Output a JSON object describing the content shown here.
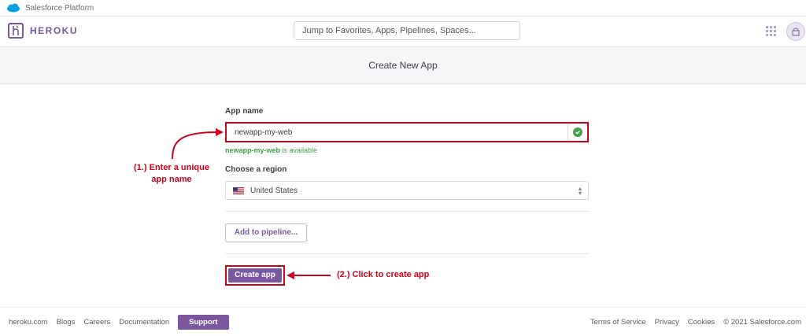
{
  "salesforce_bar": {
    "label": "Salesforce Platform"
  },
  "nav": {
    "logo_text": "HEROKU",
    "search_placeholder": "Jump to Favorites, Apps, Pipelines, Spaces..."
  },
  "page": {
    "title": "Create New App"
  },
  "form": {
    "app_name_label": "App name",
    "app_name_value": "newapp-my-web",
    "availability_name": "newapp-my-web",
    "availability_suffix": " is available",
    "region_label": "Choose a region",
    "region_value": "United States",
    "add_pipeline_label": "Add to pipeline...",
    "create_app_label": "Create app"
  },
  "annotations": {
    "step1_line1": "(1.) Enter a unique",
    "step1_line2": "app name",
    "step2": "(2.) Click to create app"
  },
  "footer": {
    "links_left": [
      "heroku.com",
      "Blogs",
      "Careers",
      "Documentation"
    ],
    "support_label": "Support",
    "links_right": [
      "Terms of Service",
      "Privacy",
      "Cookies",
      "© 2021 Salesforce.com"
    ]
  },
  "colors": {
    "brand": "#79589f",
    "annotation": "#d0021b",
    "success": "#3ea14b"
  }
}
